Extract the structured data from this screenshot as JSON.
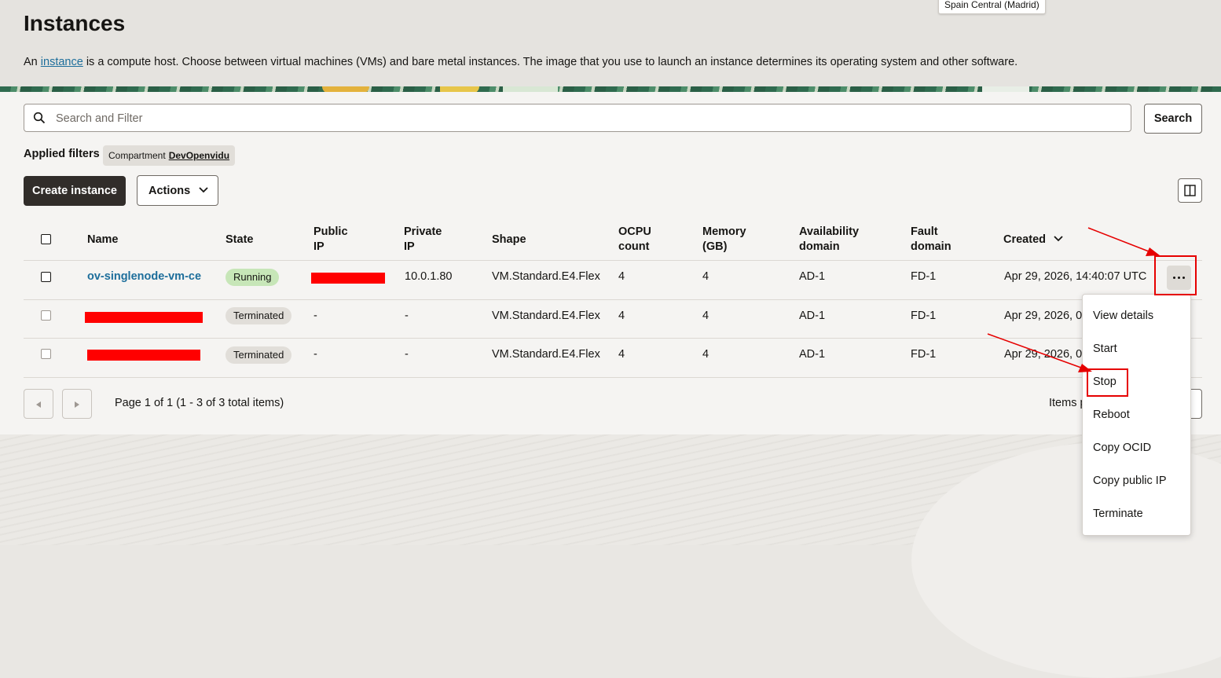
{
  "header": {
    "title": "Instances",
    "description_prefix": "An",
    "description_link": "instance",
    "description_suffix": "is a compute host. Choose between virtual machines (VMs) and bare metal instances. The image that you use to launch an instance determines its operating system and other software.",
    "region_tooltip": "Spain Central (Madrid)"
  },
  "search": {
    "placeholder": "Search and Filter",
    "value": "",
    "button_label": "Search"
  },
  "filters": {
    "label": "Applied filters",
    "chip_key": "Compartment",
    "chip_value": "DevOpenvidu"
  },
  "toolbar": {
    "create_label": "Create instance",
    "actions_label": "Actions"
  },
  "table": {
    "columns": {
      "name": "Name",
      "state": "State",
      "public_ip_1": "Public",
      "public_ip_2": "IP",
      "private_ip_1": "Private",
      "private_ip_2": "IP",
      "shape": "Shape",
      "ocpu_1": "OCPU",
      "ocpu_2": "count",
      "memory_1": "Memory",
      "memory_2": "(GB)",
      "ad_1": "Availability",
      "ad_2": "domain",
      "fd_1": "Fault",
      "fd_2": "domain",
      "created": "Created"
    },
    "rows": [
      {
        "name": "ov-singlenode-vm-ce",
        "state": "Running",
        "public_ip": "",
        "private_ip": "10.0.1.80",
        "shape": "VM.Standard.E4.Flex",
        "ocpu": "4",
        "memory": "4",
        "ad": "AD-1",
        "fd": "FD-1",
        "created": "Apr 29, 2026, 14:40:07 UTC"
      },
      {
        "name": "",
        "state": "Terminated",
        "public_ip": "-",
        "private_ip": "-",
        "shape": "VM.Standard.E4.Flex",
        "ocpu": "4",
        "memory": "4",
        "ad": "AD-1",
        "fd": "FD-1",
        "created": "Apr 29, 2026, 0"
      },
      {
        "name": "",
        "state": "Terminated",
        "public_ip": "-",
        "private_ip": "-",
        "shape": "VM.Standard.E4.Flex",
        "ocpu": "4",
        "memory": "4",
        "ad": "AD-1",
        "fd": "FD-1",
        "created": "Apr 29, 2026, 0"
      }
    ]
  },
  "pagination": {
    "summary": "Page 1 of 1 (1 - 3 of 3 total items)",
    "items_per_page_label": "Items p"
  },
  "row_menu": {
    "items": [
      "View details",
      "Start",
      "Stop",
      "Reboot",
      "Copy OCID",
      "Copy public IP",
      "Terminate"
    ]
  },
  "colors": {
    "link": "#1d6e9b",
    "primary_button": "#312d2a",
    "running_badge": "#c7e6b8",
    "terminated_badge": "#e1ded9",
    "annotation": "#e60000",
    "redaction": "#ff0000"
  }
}
